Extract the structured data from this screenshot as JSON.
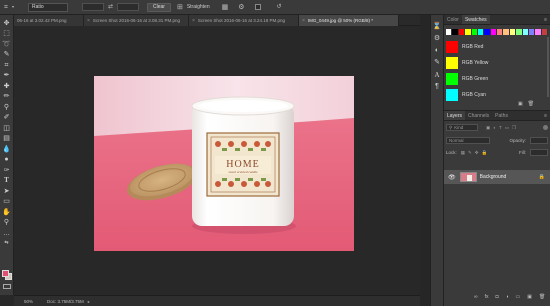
{
  "options_bar": {
    "ratio_select": "Ratio",
    "clear_label": "Clear",
    "straighten_label": "Straighten"
  },
  "tabs": [
    {
      "label": "06-16 at 3.02.42 PM.png",
      "active": false
    },
    {
      "label": "Screen Shot 2016-06-16 at 3.08.31 PM.png",
      "active": false
    },
    {
      "label": "Screen Shot 2016-06-16 at 3.24.18 PM.png",
      "active": false
    },
    {
      "label": "IMG_0449.jpg @ 50% (RGB/8) *",
      "active": true
    }
  ],
  "status_bar": {
    "zoom": "50%",
    "doc_info": "Doc: 3.75M/3.75M"
  },
  "swatches_panel": {
    "tabs": [
      "Color",
      "Swatches"
    ],
    "active_tab": "Swatches",
    "items": [
      {
        "label": "RGB Red",
        "color": "#ff0000"
      },
      {
        "label": "RGB Yellow",
        "color": "#ffff00"
      },
      {
        "label": "RGB Green",
        "color": "#00ff00"
      },
      {
        "label": "RGB Cyan",
        "color": "#00ffff"
      }
    ],
    "swatch_row_colors": [
      "#ffffff",
      "#000000",
      "#ff0000",
      "#ffff00",
      "#00ff00",
      "#00ffff",
      "#0000ff",
      "#ff00ff",
      "#ff8080",
      "#ffc080",
      "#ffff80",
      "#80ff80",
      "#80ffff",
      "#8080ff",
      "#ff80ff",
      "#c04040"
    ]
  },
  "layers_panel": {
    "tabs": [
      "Layers",
      "Channels",
      "Paths"
    ],
    "active_tab": "Layers",
    "kind_filter": "Kind",
    "blend_mode": "Normal",
    "opacity_label": "Opacity:",
    "fill_label": "Fill:",
    "lock_label": "Lock:",
    "layers": [
      {
        "name": "Background",
        "visible": true,
        "locked": true
      }
    ]
  },
  "photo": {
    "label_title": "HOME",
    "label_sub": "sweet scented candle",
    "table_color": "#e9677f",
    "wall_color": "#f3d4dc"
  },
  "toolbar": {
    "foreground_color": "#e14f75",
    "background_color": "#d2c6b8"
  }
}
